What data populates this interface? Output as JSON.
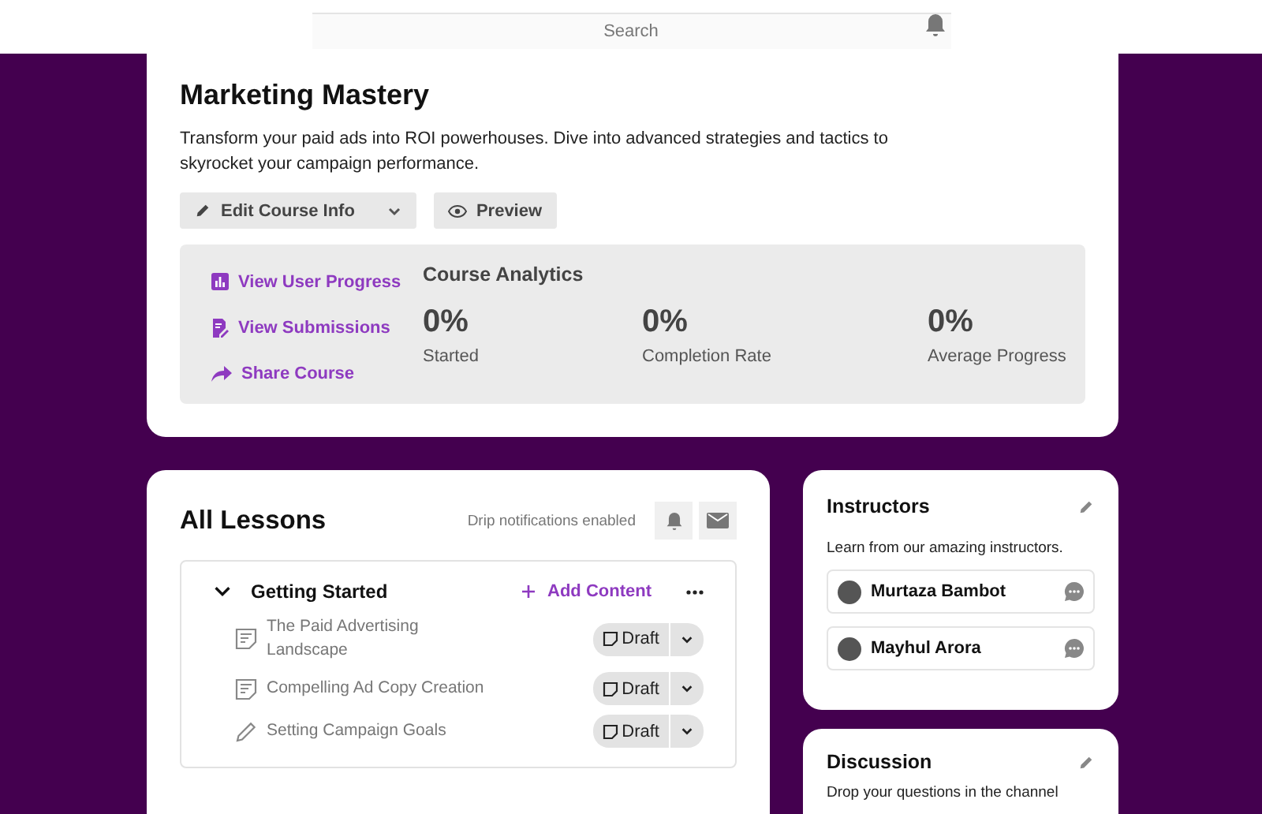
{
  "header": {
    "search": {
      "placeholder": "Search"
    }
  },
  "course": {
    "title": "Marketing Mastery",
    "description": "Transform your paid ads into ROI powerhouses. Dive into advanced strategies and tactics to skyrocket your campaign performance.",
    "actions": [
      {
        "label": "Edit Course Info",
        "kind": "edit"
      },
      {
        "label": "Preview",
        "kind": "preview"
      }
    ],
    "links": [
      {
        "label": "View User Progress",
        "kind": "chart"
      },
      {
        "label": "View Submissions",
        "kind": "submissions"
      },
      {
        "label": "Share Course",
        "kind": "share"
      }
    ],
    "analytics": {
      "title": "Course Analytics",
      "stats": [
        {
          "value": "0%",
          "label": "Started"
        },
        {
          "value": "0%",
          "label": "Completion Rate"
        },
        {
          "value": "0%",
          "label": "Average Progress"
        }
      ]
    }
  },
  "lessons": {
    "title": "All Lessons",
    "drip_note": "Drip notifications enabled",
    "sections": [
      {
        "title": "Getting Started",
        "expanded": true,
        "add_label": "Add Content",
        "items": [
          {
            "title": "The Paid Advertising Landscape",
            "kind": "note",
            "status": "Draft"
          },
          {
            "title": "Compelling Ad Copy Creation",
            "kind": "note",
            "status": "Draft"
          },
          {
            "title": "Setting Campaign Goals",
            "kind": "pencil",
            "status": "Draft"
          }
        ]
      }
    ]
  },
  "instructors": {
    "title": "Instructors",
    "subtitle": "Learn from our amazing instructors.",
    "people": [
      {
        "name": "Murtaza Bambot"
      },
      {
        "name": "Mayhul Arora"
      }
    ]
  },
  "discussion": {
    "title": "Discussion",
    "text": "Drop your questions in the channel"
  }
}
